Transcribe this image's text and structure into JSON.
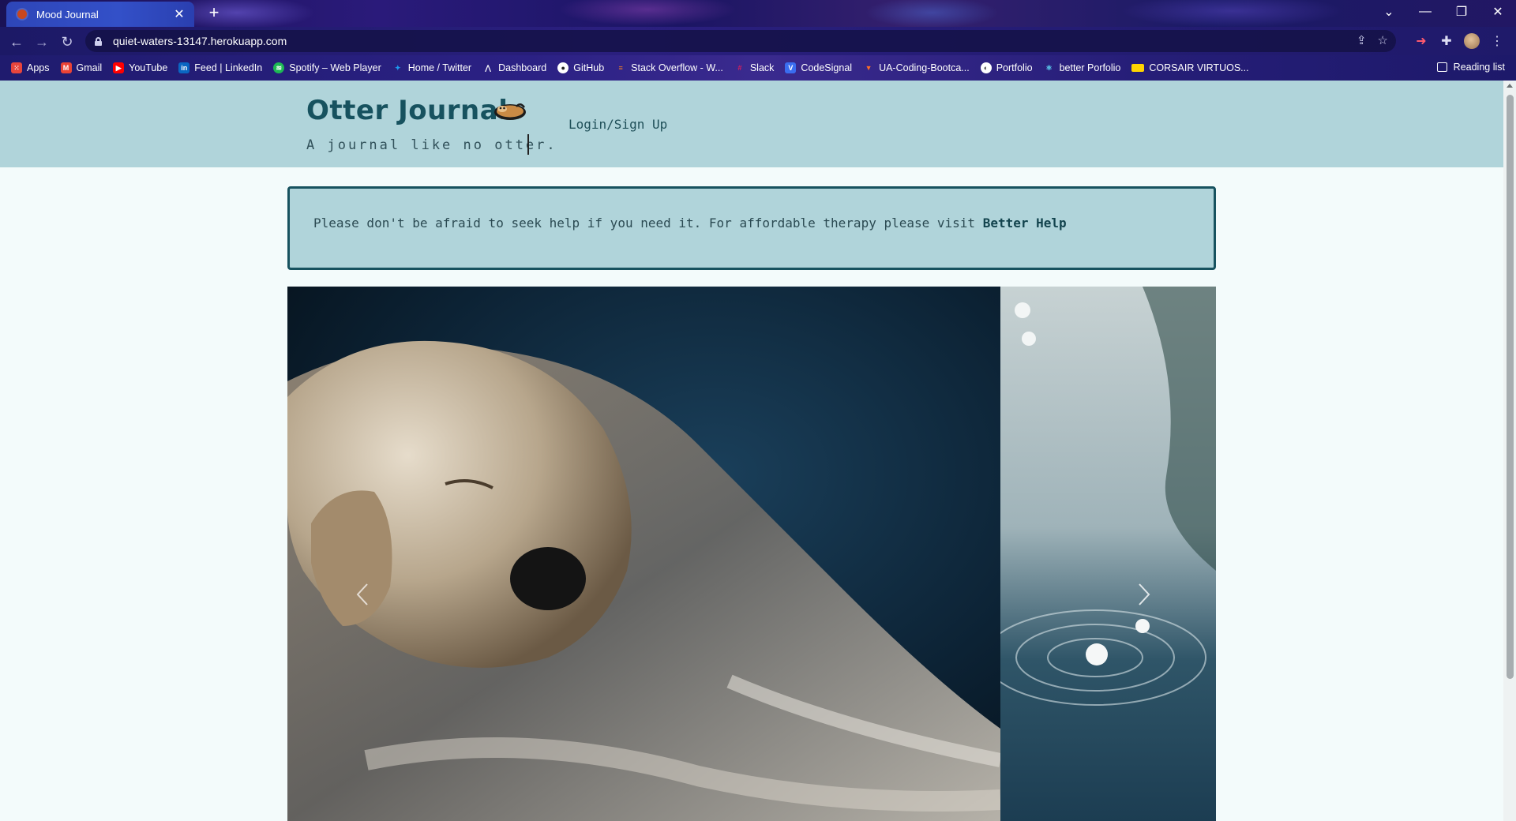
{
  "browser": {
    "tab": {
      "title": "Mood Journal"
    },
    "url": "quiet-waters-13147.herokuapp.com",
    "bookmarks": [
      {
        "label": "Apps",
        "icon": "apps-grid-icon",
        "color": "#e8453c"
      },
      {
        "label": "Gmail",
        "icon": "gmail-icon",
        "color": "#ea4335"
      },
      {
        "label": "YouTube",
        "icon": "youtube-icon",
        "color": "#ff0000"
      },
      {
        "label": "Feed | LinkedIn",
        "icon": "linkedin-icon",
        "color": "#0a66c2"
      },
      {
        "label": "Spotify – Web Player",
        "icon": "spotify-icon",
        "color": "#1db954"
      },
      {
        "label": "Home / Twitter",
        "icon": "twitter-icon",
        "color": "#1d9bf0"
      },
      {
        "label": "Dashboard",
        "icon": "dashboard-icon",
        "color": "#ffffff"
      },
      {
        "label": "GitHub",
        "icon": "github-icon",
        "color": "#ffffff"
      },
      {
        "label": "Stack Overflow - W...",
        "icon": "stackoverflow-icon",
        "color": "#f48024"
      },
      {
        "label": "Slack",
        "icon": "slack-icon",
        "color": "#e01e5a"
      },
      {
        "label": "CodeSignal",
        "icon": "codesignal-icon",
        "color": "#3a6df0"
      },
      {
        "label": "UA-Coding-Bootca...",
        "icon": "gitlab-icon",
        "color": "#fc6d26"
      },
      {
        "label": "Portfolio",
        "icon": "portfolio-icon",
        "color": "#ffffff"
      },
      {
        "label": "better Porfolio",
        "icon": "react-icon",
        "color": "#5ed3f3"
      },
      {
        "label": "CORSAIR VIRTUOS...",
        "icon": "corsair-icon",
        "color": "#ffd400"
      }
    ],
    "reading_list": "Reading list"
  },
  "site": {
    "title": "Otter Journal",
    "tagline": "A journal like no otter.",
    "login_link": "Login/Sign Up",
    "notice": {
      "text": "Please don't be afraid to seek help if you need it. For affordable therapy please visit ",
      "link_text": "Better Help"
    }
  },
  "colors": {
    "header_bg": "#b0d4da",
    "brand_text": "#17525f",
    "page_bg": "#f3fbfb"
  }
}
